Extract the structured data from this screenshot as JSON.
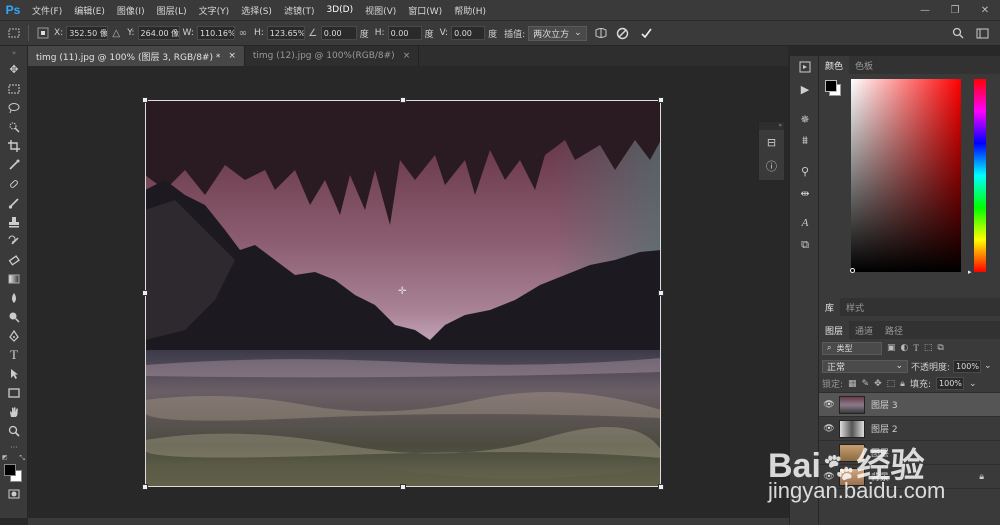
{
  "app": {
    "logo": "Ps"
  },
  "menu": [
    "文件(F)",
    "编辑(E)",
    "图像(I)",
    "图层(L)",
    "文字(Y)",
    "选择(S)",
    "滤镜(T)",
    "3D(D)",
    "视图(V)",
    "窗口(W)",
    "帮助(H)"
  ],
  "window_controls": [
    "—",
    "❐",
    "✕"
  ],
  "options": {
    "x_label": "X:",
    "x_value": "352.50 像素",
    "y_label": "Y:",
    "y_value": "264.00 像素",
    "w_label": "W:",
    "w_value": "110.16%",
    "h_label": "H:",
    "h_value": "123.65%",
    "angle_value": "0.00",
    "angle_unit": "度",
    "hskew_label": "H:",
    "hskew_value": "0.00",
    "hskew_unit": "度",
    "vskew_label": "V:",
    "vskew_value": "0.00",
    "vskew_unit": "度",
    "interp_label": "插值:",
    "interp_value": "两次立方"
  },
  "tabs": [
    {
      "label": "timg (11).jpg @ 100% (图层 3, RGB/8#) *",
      "close": "×"
    },
    {
      "label": "timg (12).jpg @ 100%(RGB/8#)",
      "close": "×"
    }
  ],
  "color_panel": {
    "tabs": [
      "颜色",
      "色板"
    ],
    "foreground": "#000000",
    "background": "#ffffff",
    "hue_color": "#ff0000"
  },
  "library_panel": {
    "tabs": [
      "库",
      "样式"
    ]
  },
  "layers_panel": {
    "tabs": [
      "图层",
      "通道",
      "路径"
    ],
    "filter_kind": "类型",
    "blend_mode": "正常",
    "opacity_label": "不透明度:",
    "opacity_value": "100%",
    "lock_label": "锁定:",
    "fill_label": "填充:",
    "fill_value": "100%",
    "layers": [
      {
        "name": "图层 3",
        "visible": true,
        "selected": true
      },
      {
        "name": "图层 2",
        "visible": true,
        "selected": false
      },
      {
        "name": "图层",
        "visible": false,
        "selected": false
      },
      {
        "name": "背景",
        "visible": true,
        "selected": false
      }
    ]
  },
  "watermark": {
    "brand_a": "Bai",
    "brand_b": "经验",
    "url": "jingyan.baidu.com"
  }
}
